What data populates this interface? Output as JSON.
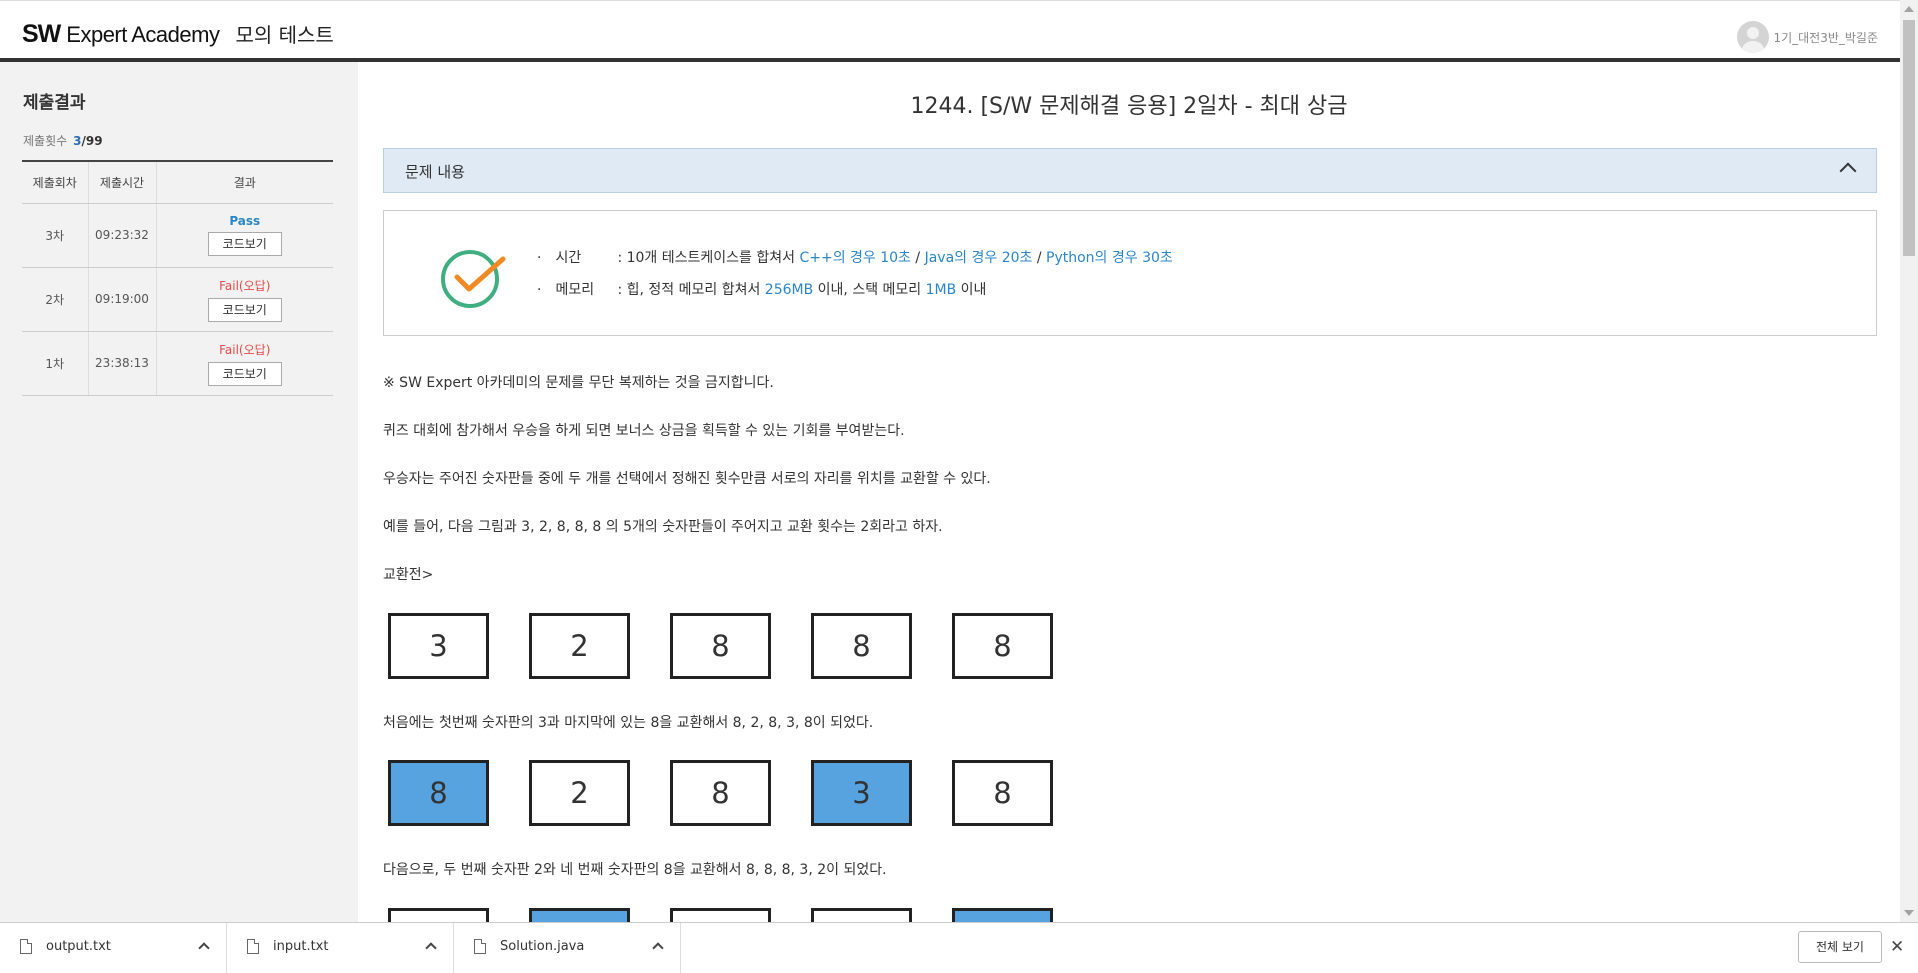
{
  "header": {
    "brand_sw": "SW",
    "brand_rest": "Expert Academy",
    "brand_sub": "모의 테스트",
    "user_name": "1기_대전3반_박길준"
  },
  "sidebar": {
    "title": "제출결과",
    "count_label": "제출횟수",
    "count_value": "3",
    "count_total": "/99",
    "columns": [
      "제출회차",
      "제출시간",
      "결과"
    ],
    "rows": [
      {
        "round": "3차",
        "time": "09:23:32",
        "result": "Pass",
        "button": "코드보기"
      },
      {
        "round": "2차",
        "time": "09:19:00",
        "result": "Fail(오답)",
        "button": "코드보기"
      },
      {
        "round": "1차",
        "time": "23:38:13",
        "result": "Fail(오답)",
        "button": "코드보기"
      }
    ]
  },
  "problem": {
    "title": "1244. [S/W 문제해결 응용] 2일차 - 최대 상금",
    "section_label": "문제 내용",
    "limits": {
      "time_label": "시간",
      "time_prefix": ": 10개 테스트케이스를 합쳐서",
      "time_cpp": "C++의 경우 10초",
      "time_java": "Java의 경우 20초",
      "time_python": "Python의 경우 30초",
      "mem_label": "메모리",
      "mem_prefix": ": 힙, 정적 메모리 합쳐서",
      "mem_heap": "256MB",
      "mem_mid": "이내, 스택 메모리",
      "mem_stack": "1MB",
      "mem_suffix": "이내"
    },
    "paragraphs": [
      "※ SW Expert 아카데미의 문제를 무단 복제하는 것을 금지합니다.",
      "퀴즈 대회에 참가해서 우승을 하게 되면 보너스 상금을 획득할 수 있는 기회를 부여받는다.",
      "우승자는 주어진 숫자판들 중에 두 개를 선택에서 정해진 횟수만큼 서로의 자리를 위치를 교환할 수 있다.",
      "예를 들어, 다음 그림과 3, 2, 8, 8, 8 의 5개의 숫자판들이 주어지고 교환 횟수는 2회라고 하자.",
      "교환전>",
      "처음에는 첫번째 숫자판의 3과 마지막에 있는 8을 교환해서 8, 2, 8, 3, 8이 되었다.",
      "다음으로, 두 번째 숫자판 2와 네 번째 숫자판의 8을 교환해서 8, 8, 8, 3, 2이 되었다."
    ],
    "box_rows": [
      {
        "digits": [
          "3",
          "2",
          "8",
          "8",
          "8"
        ],
        "highlight": [
          false,
          false,
          false,
          false,
          false
        ]
      },
      {
        "digits": [
          "8",
          "2",
          "8",
          "3",
          "8"
        ],
        "highlight": [
          true,
          false,
          false,
          true,
          false
        ]
      },
      {
        "digits": [
          "",
          "",
          "",
          "",
          ""
        ],
        "highlight": [
          false,
          true,
          false,
          false,
          true
        ]
      }
    ]
  },
  "downloads": {
    "files": [
      "output.txt",
      "input.txt",
      "Solution.java"
    ],
    "show_all": "전체 보기",
    "close": "✕"
  },
  "colors": {
    "accent_blue": "#2a86c8",
    "fail_red": "#e04a4a",
    "highlight_box": "#56a3e0",
    "check_green": "#3fae80",
    "check_orange": "#f08a24"
  }
}
